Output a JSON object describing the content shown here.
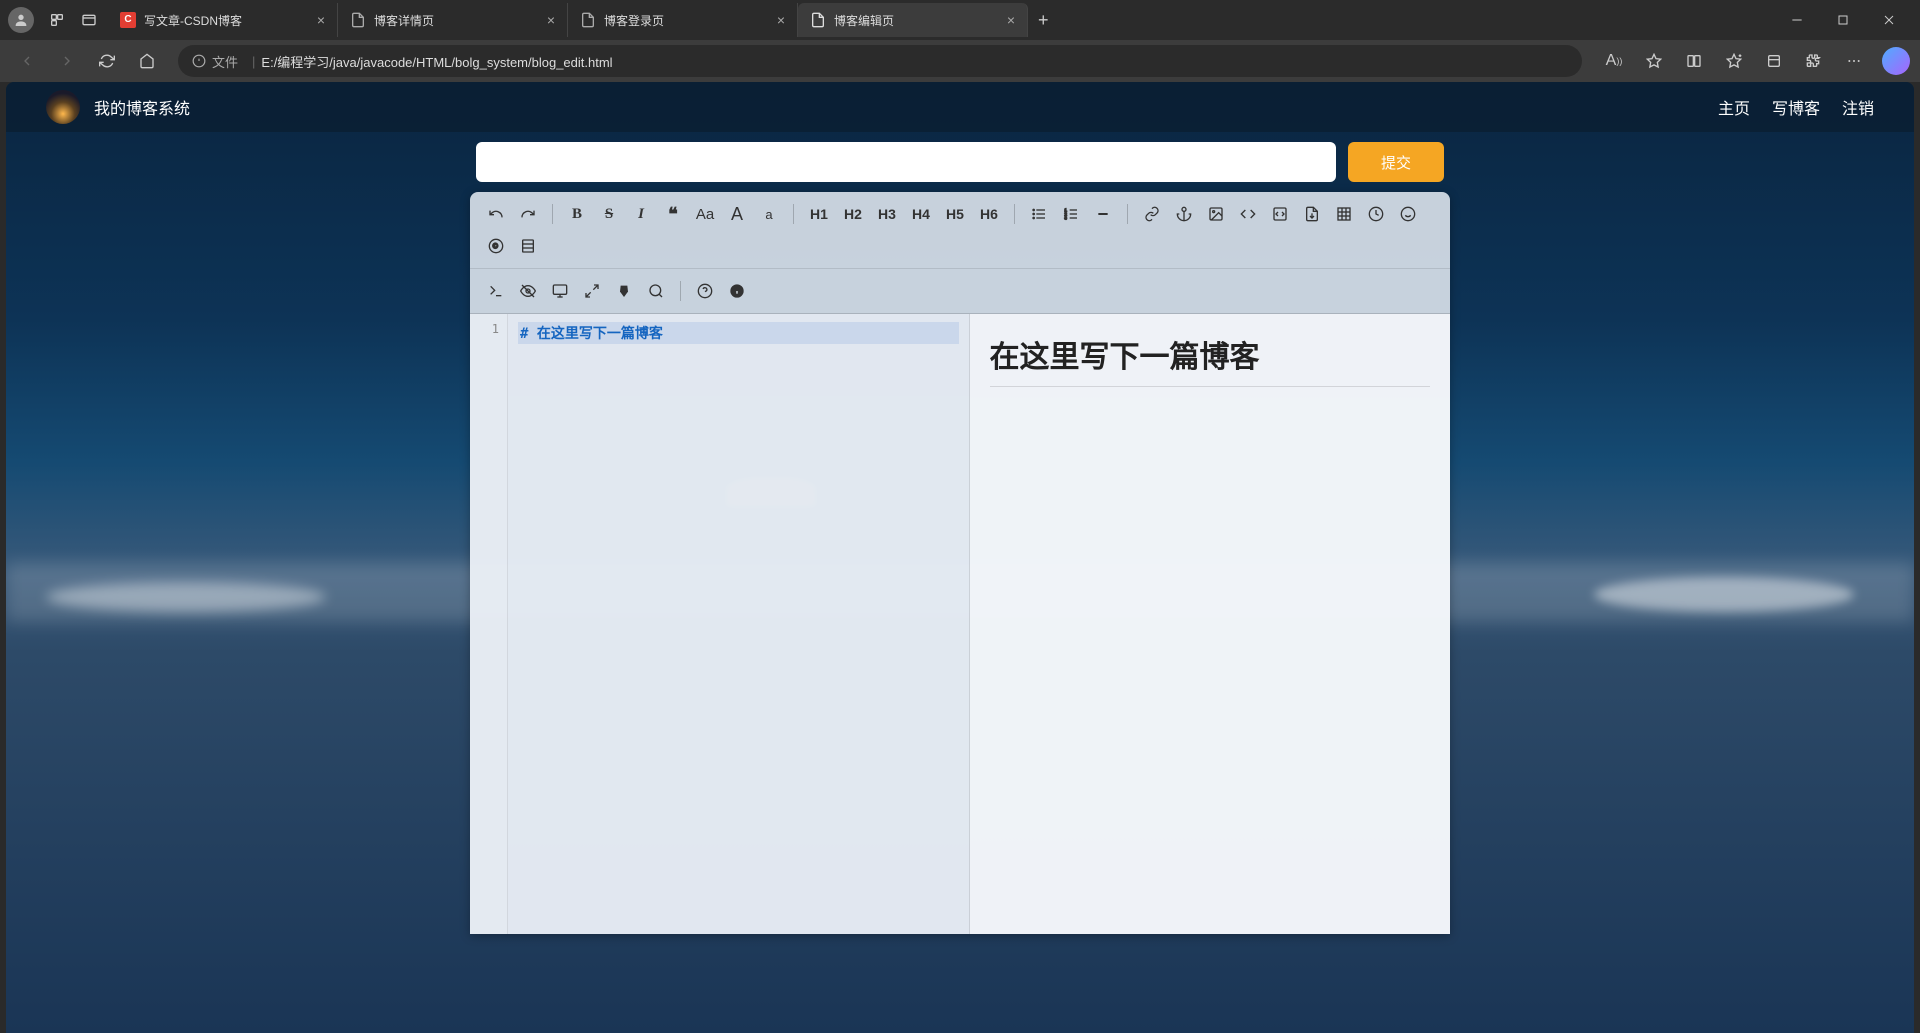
{
  "browser": {
    "tabs": [
      {
        "title": "写文章-CSDN博客",
        "icon": "csdn"
      },
      {
        "title": "博客详情页",
        "icon": "file"
      },
      {
        "title": "博客登录页",
        "icon": "file"
      },
      {
        "title": "博客编辑页",
        "icon": "file",
        "active": true
      }
    ],
    "url_prefix": "文件",
    "url": "E:/编程学习/java/javacode/HTML/bolg_system/blog_edit.html"
  },
  "site": {
    "title": "我的博客系统",
    "nav": {
      "home": "主页",
      "write": "写博客",
      "logout": "注销"
    }
  },
  "compose": {
    "title_value": "",
    "submit_label": "提交"
  },
  "toolbar": {
    "headings": [
      "H1",
      "H2",
      "H3",
      "H4",
      "H5",
      "H6"
    ]
  },
  "editor": {
    "line_number": "1",
    "hash": "#",
    "src_text": "在这里写下一篇博客",
    "preview_heading": "在这里写下一篇博客"
  }
}
